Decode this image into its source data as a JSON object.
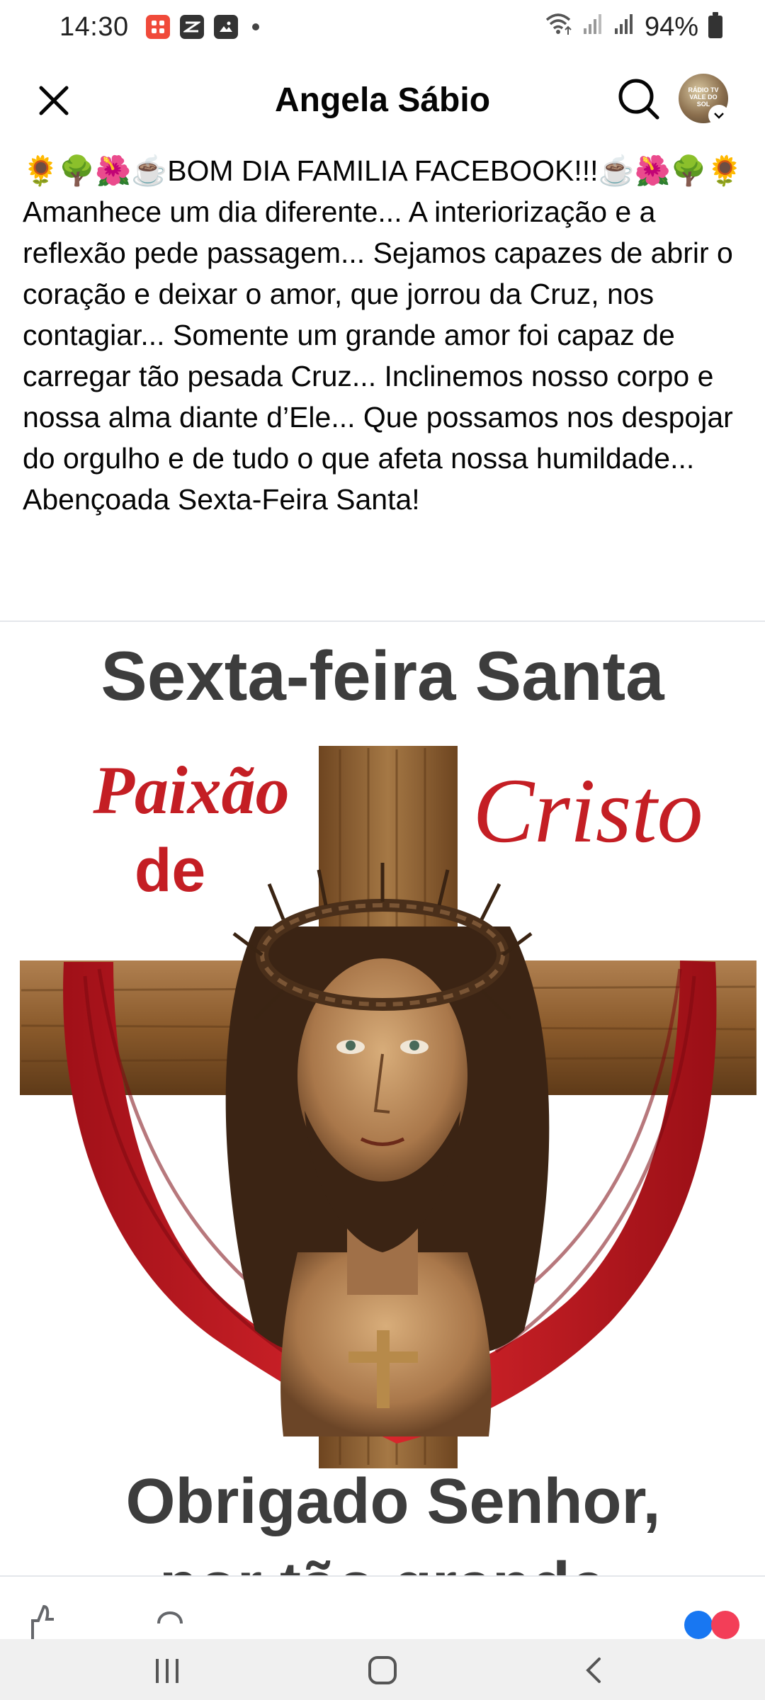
{
  "status_bar": {
    "time": "14:30",
    "battery": "94%"
  },
  "header": {
    "title": "Angela Sábio",
    "close_icon": "close-icon",
    "search_icon": "search-icon",
    "avatar_text": "RÁDIO TV VALE DO SOL"
  },
  "post": {
    "greeting": "🌻🌳🌺☕BOM DIA FAMILIA FACEBOOK!!!☕🌺🌳🌻",
    "body": "Amanhece um dia diferente... A interiorização e a reflexão pede passagem... Sejamos capazes de abrir o coração e deixar o amor, que jorrou da Cruz, nos contagiar... Somente um grande amor foi capaz de carregar tão pesada Cruz... Inclinemos nosso corpo e nossa alma diante d’Ele... Que possamos nos despojar do orgulho e de tudo o que afeta nossa humildade... Abençoada Sexta-Feira Santa!"
  },
  "image": {
    "title": "Sexta-feira Santa",
    "line_paixao": "Paixão",
    "line_de": "de",
    "line_cristo": "Cristo",
    "line_obrigado": "Obrigado Senhor,",
    "line_partial": "por tão grande"
  },
  "colors": {
    "red": "#c41e24",
    "wood": "#8a5a2b",
    "title_gray": "#3d3d3d"
  }
}
